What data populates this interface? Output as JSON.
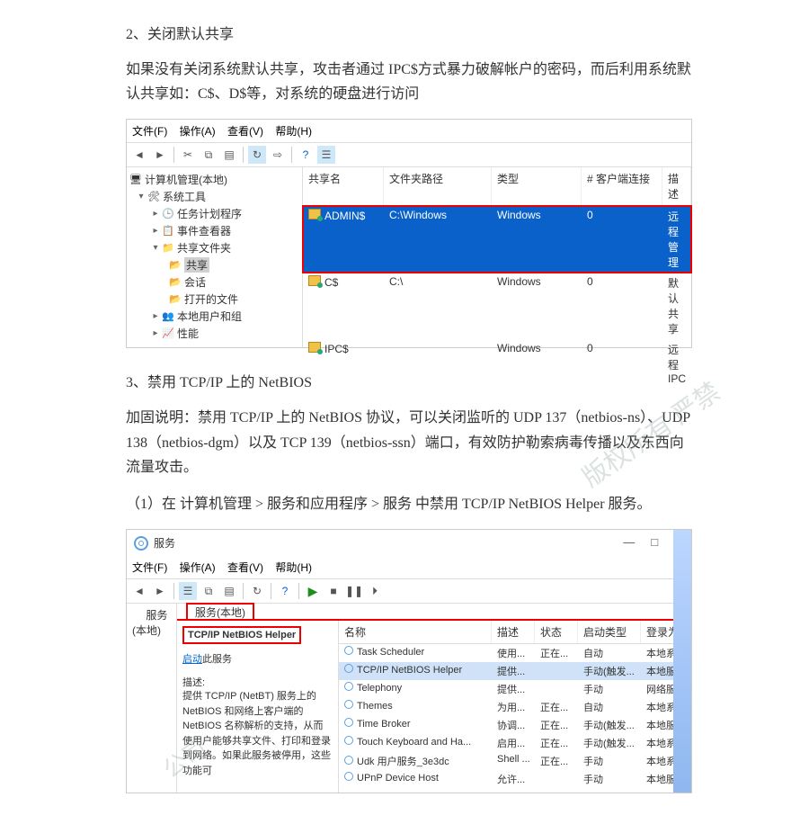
{
  "section2": {
    "heading": "2、关闭默认共享",
    "para": "如果没有关闭系统默认共享，攻击者通过 IPC$方式暴力破解帐户的密码，而后利用系统默认共享如：C$、D$等，对系统的硬盘进行访问"
  },
  "section3": {
    "heading": "3、禁用 TCP/IP 上的 NetBIOS",
    "para1": "加固说明：禁用 TCP/IP 上的 NetBIOS 协议，可以关闭监听的 UDP 137（netbios-ns）、UDP 138（netbios-dgm）以及 TCP 139（netbios-ssn）端口，有效防护勒索病毒传播以及东西向流量攻击。",
    "para2": "（1）在 计算机管理 > 服务和应用程序 > 服务 中禁用 TCP/IP NetBIOS Helper 服务。"
  },
  "cm": {
    "menu": {
      "file": "文件(F)",
      "action": "操作(A)",
      "view": "查看(V)",
      "help": "帮助(H)"
    },
    "tree": {
      "root": "计算机管理(本地)",
      "systools": "系统工具",
      "tasksched": "任务计划程序",
      "eventvwr": "事件查看器",
      "shared": "共享文件夹",
      "shares": "共享",
      "sessions": "会话",
      "openfiles": "打开的文件",
      "localusers": "本地用户和组",
      "perf": "性能"
    },
    "cols": {
      "c1": "共享名",
      "c2": "文件夹路径",
      "c3": "类型",
      "c4": "# 客户端连接",
      "c5": "描述"
    },
    "rows": [
      {
        "name": "ADMIN$",
        "path": "C:\\Windows",
        "type": "Windows",
        "conn": "0",
        "desc": "远程管理"
      },
      {
        "name": "C$",
        "path": "C:\\",
        "type": "Windows",
        "conn": "0",
        "desc": "默认共享"
      },
      {
        "name": "IPC$",
        "path": "",
        "type": "Windows",
        "conn": "0",
        "desc": "远程 IPC"
      }
    ]
  },
  "svc": {
    "title": "服务",
    "menu": {
      "file": "文件(F)",
      "action": "操作(A)",
      "view": "查看(V)",
      "help": "帮助(H)"
    },
    "left_label": "服务(本地)",
    "redtab": "服务(本地)",
    "detail": {
      "name": "TCP/IP NetBIOS Helper",
      "start_link": "启动",
      "start_suffix": "此服务",
      "desc_label": "描述:",
      "desc": "提供 TCP/IP (NetBT) 服务上的 NetBIOS 和网络上客户端的 NetBIOS 名称解析的支持，从而使用户能够共享文件、打印和登录到网络。如果此服务被停用，这些功能可"
    },
    "cols": {
      "c1": "名称",
      "c2": "描述",
      "c3": "状态",
      "c4": "启动类型",
      "c5": "登录为"
    },
    "rows": [
      {
        "name": "Task Scheduler",
        "desc": "使用...",
        "state": "正在...",
        "start": "自动",
        "logon": "本地系统"
      },
      {
        "name": "TCP/IP NetBIOS Helper",
        "desc": "提供...",
        "state": "",
        "start": "手动(触发...",
        "logon": "本地服务"
      },
      {
        "name": "Telephony",
        "desc": "提供...",
        "state": "",
        "start": "手动",
        "logon": "网络服务"
      },
      {
        "name": "Themes",
        "desc": "为用...",
        "state": "正在...",
        "start": "自动",
        "logon": "本地系统"
      },
      {
        "name": "Time Broker",
        "desc": "协调...",
        "state": "正在...",
        "start": "手动(触发...",
        "logon": "本地服务"
      },
      {
        "name": "Touch Keyboard and Ha...",
        "desc": "启用...",
        "state": "正在...",
        "start": "手动(触发...",
        "logon": "本地系统"
      },
      {
        "name": "Udk 用户服务_3e3dc",
        "desc": "Shell ...",
        "state": "正在...",
        "start": "手动",
        "logon": "本地系统"
      },
      {
        "name": "UPnP Device Host",
        "desc": "允许...",
        "state": "",
        "start": "手动",
        "logon": "本地服务"
      }
    ]
  }
}
